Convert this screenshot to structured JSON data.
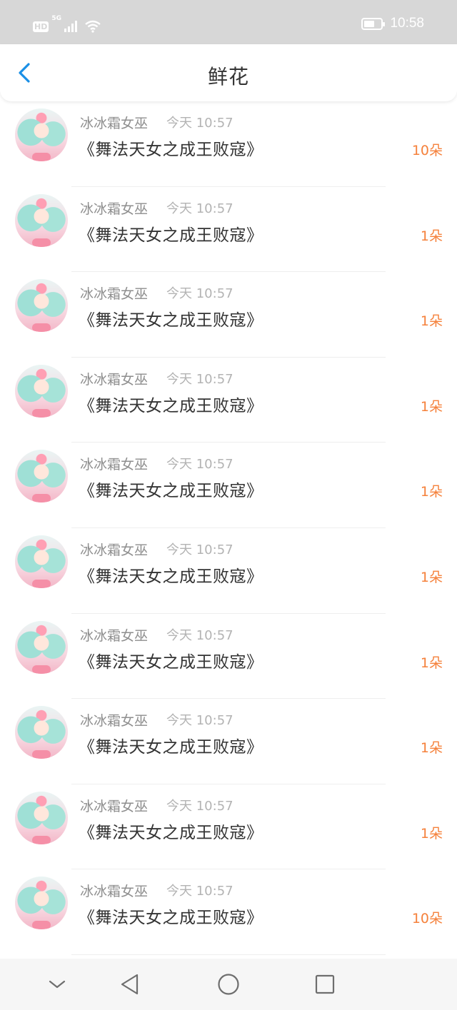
{
  "status_bar": {
    "hd_badge": "HD",
    "network_label": "5G",
    "time": "10:58",
    "icons": [
      "hd-icon",
      "signal-icon",
      "wifi-icon",
      "battery-icon"
    ]
  },
  "header": {
    "title": "鲜花",
    "back_icon": "chevron-left-icon"
  },
  "accent_color": "#1a8fe6",
  "count_color": "#f5813b",
  "items": [
    {
      "user": "冰冰霜女巫",
      "time": "今天 10:57",
      "title": "《舞法天女之成王败寇》",
      "count": "10朵"
    },
    {
      "user": "冰冰霜女巫",
      "time": "今天 10:57",
      "title": "《舞法天女之成王败寇》",
      "count": "1朵"
    },
    {
      "user": "冰冰霜女巫",
      "time": "今天 10:57",
      "title": "《舞法天女之成王败寇》",
      "count": "1朵"
    },
    {
      "user": "冰冰霜女巫",
      "time": "今天 10:57",
      "title": "《舞法天女之成王败寇》",
      "count": "1朵"
    },
    {
      "user": "冰冰霜女巫",
      "time": "今天 10:57",
      "title": "《舞法天女之成王败寇》",
      "count": "1朵"
    },
    {
      "user": "冰冰霜女巫",
      "time": "今天 10:57",
      "title": "《舞法天女之成王败寇》",
      "count": "1朵"
    },
    {
      "user": "冰冰霜女巫",
      "time": "今天 10:57",
      "title": "《舞法天女之成王败寇》",
      "count": "1朵"
    },
    {
      "user": "冰冰霜女巫",
      "time": "今天 10:57",
      "title": "《舞法天女之成王败寇》",
      "count": "1朵"
    },
    {
      "user": "冰冰霜女巫",
      "time": "今天 10:57",
      "title": "《舞法天女之成王败寇》",
      "count": "1朵"
    },
    {
      "user": "冰冰霜女巫",
      "time": "今天 10:57",
      "title": "《舞法天女之成王败寇》",
      "count": "10朵"
    }
  ],
  "nav_bar": {
    "icons": [
      "hide-keyboard-icon",
      "back-triangle-icon",
      "home-circle-icon",
      "recents-square-icon"
    ]
  }
}
